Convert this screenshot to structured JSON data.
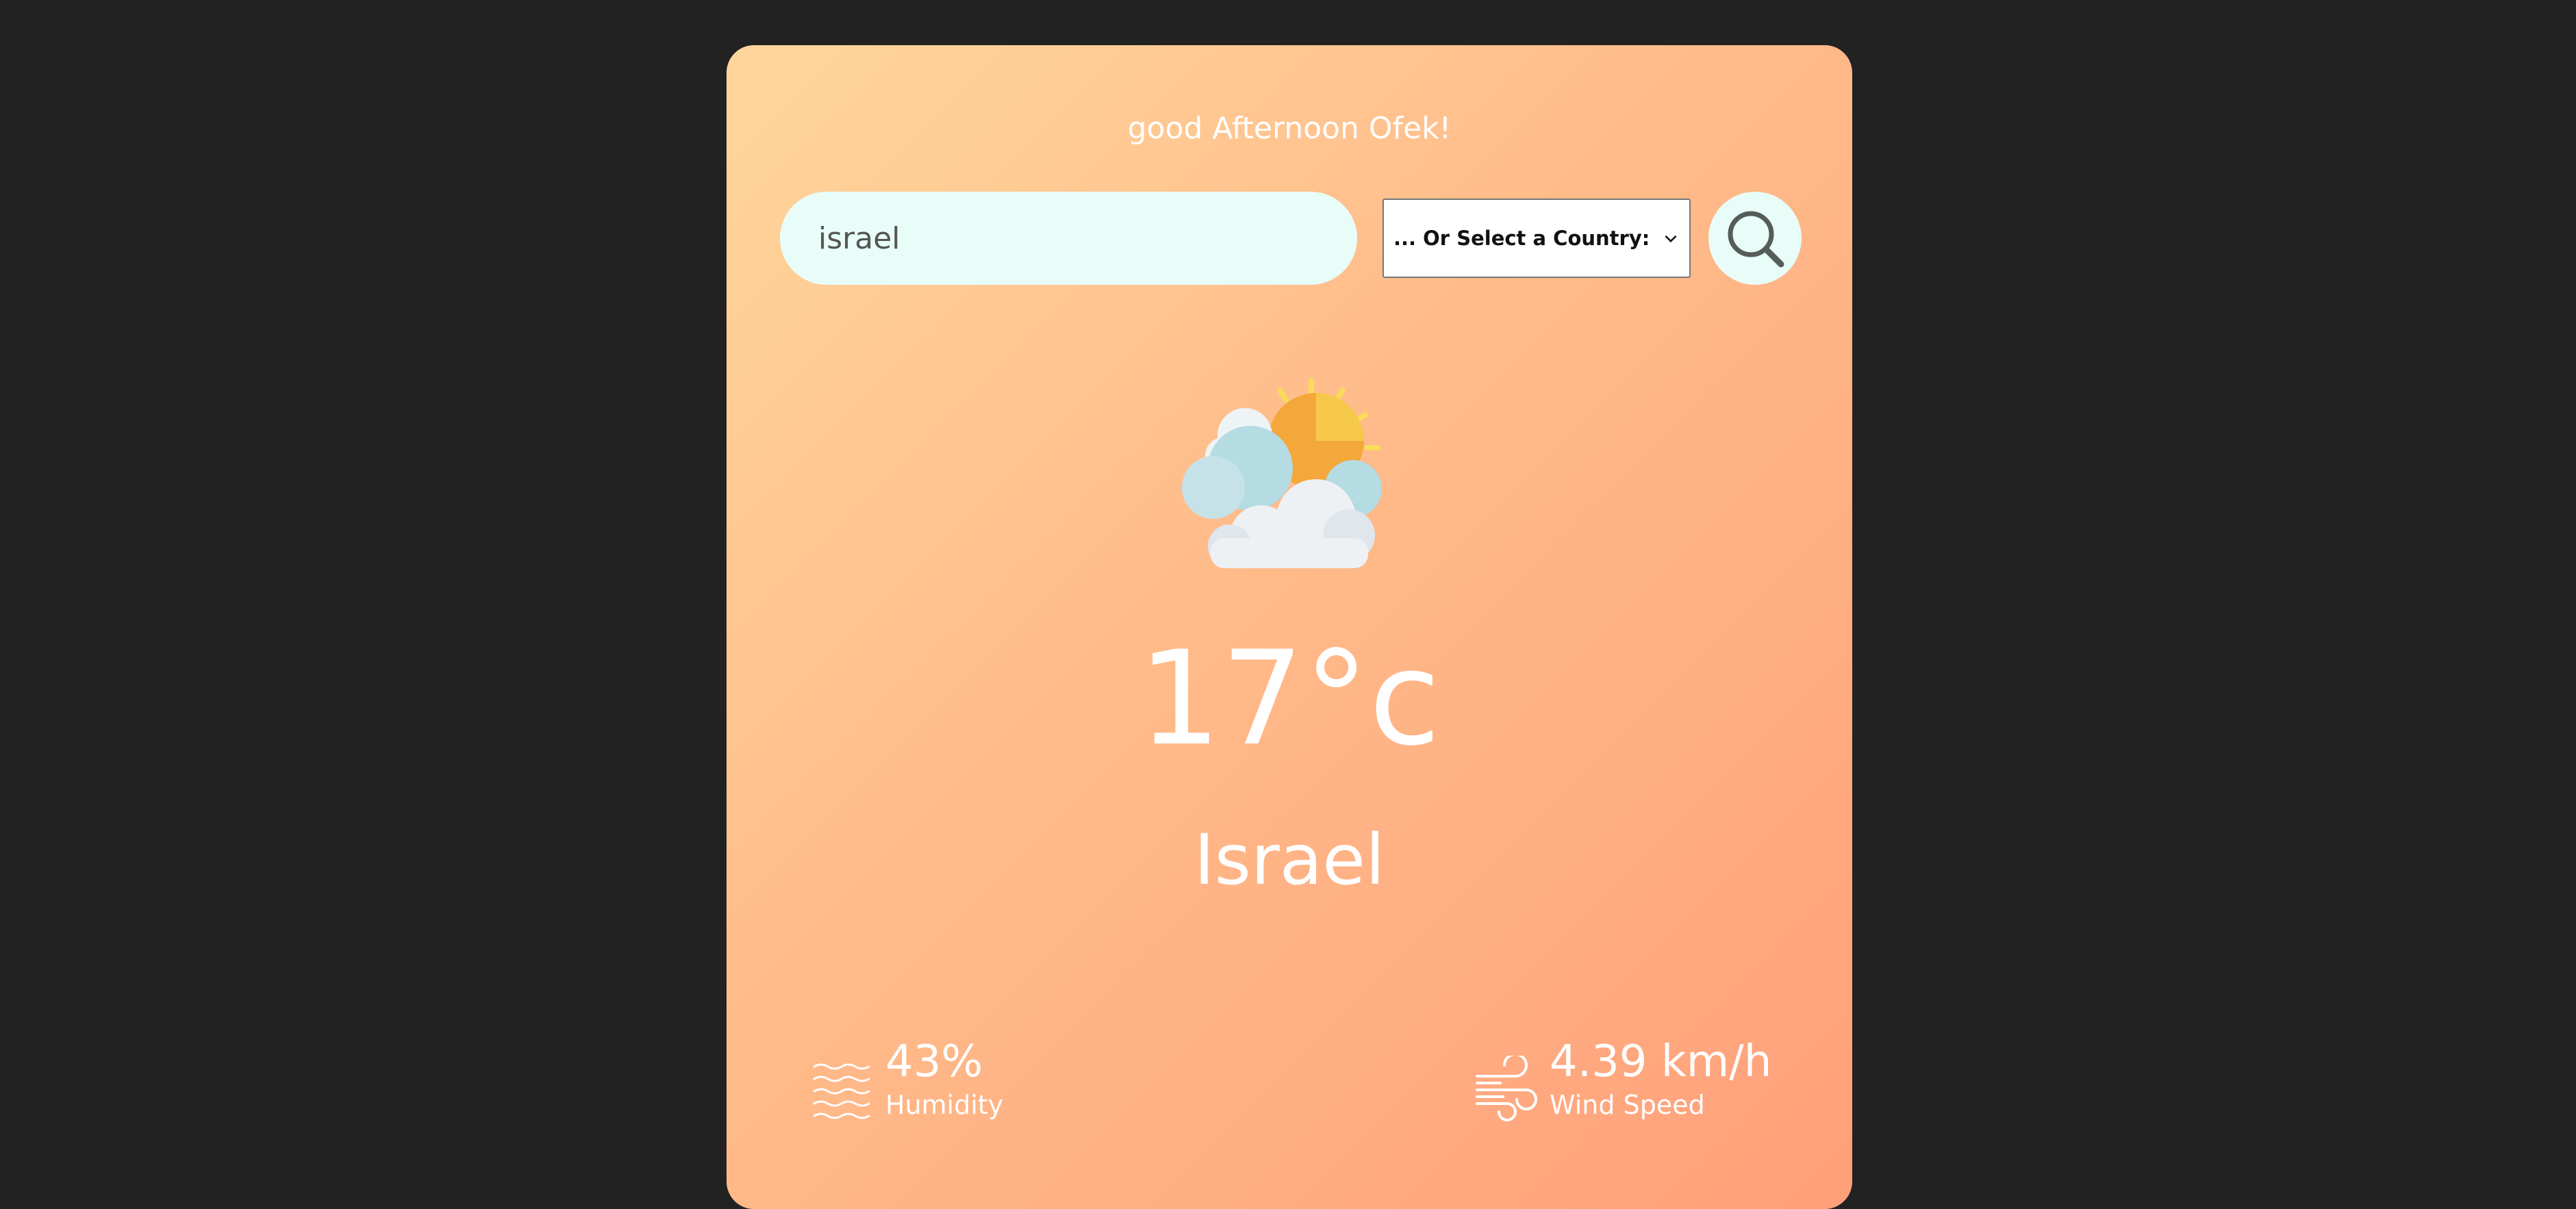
{
  "greeting": "good Afternoon Ofek!",
  "search": {
    "value": "israel",
    "country_select_label": "... Or Select a Country:"
  },
  "weather": {
    "icon": "partly-cloudy-icon",
    "temperature": "17°c",
    "city": "Israel"
  },
  "stats": {
    "humidity": {
      "value": "43%",
      "label": "Humidity",
      "icon": "humidity-waves-icon"
    },
    "wind": {
      "value": "4.39 km/h",
      "label": "Wind Speed",
      "icon": "wind-icon"
    }
  },
  "colors": {
    "page_background": "#222222",
    "card_gradient_start": "#ffd69c",
    "card_gradient_end": "#ff9f7a",
    "input_background": "#e8fdf8",
    "text": "#ffffff"
  }
}
